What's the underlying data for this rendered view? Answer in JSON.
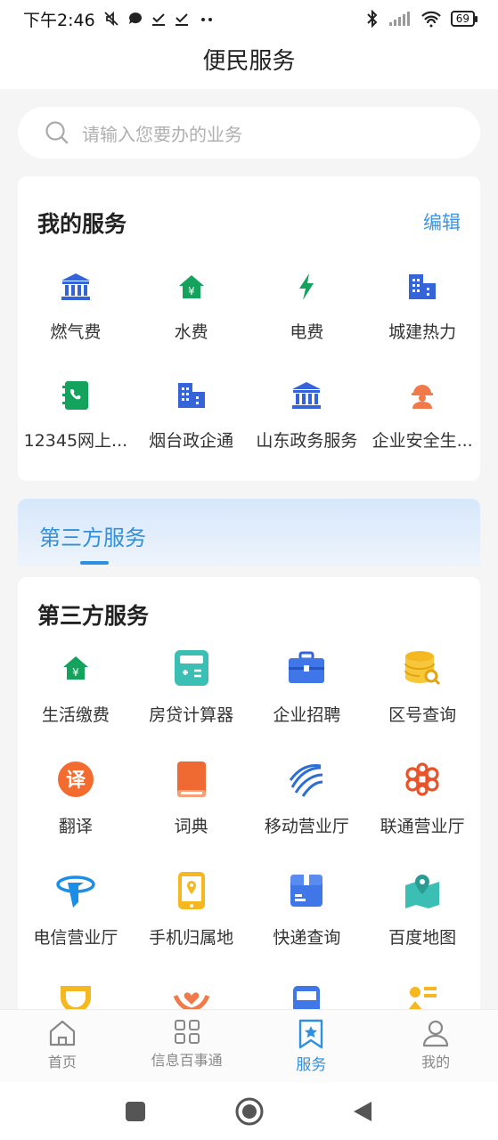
{
  "status_bar": {
    "time": "下午2:46",
    "battery": "69"
  },
  "header": {
    "title": "便民服务"
  },
  "search": {
    "placeholder": "请输入您要办的业务"
  },
  "my_services": {
    "title": "我的服务",
    "edit_label": "编辑",
    "items": [
      {
        "label": "燃气费",
        "icon": "bank-icon"
      },
      {
        "label": "水费",
        "icon": "house-yen-icon"
      },
      {
        "label": "电费",
        "icon": "lightning-icon"
      },
      {
        "label": "城建热力",
        "icon": "building-icon"
      },
      {
        "label": "12345网上...",
        "icon": "phonebook-icon"
      },
      {
        "label": "烟台政企通",
        "icon": "building-icon"
      },
      {
        "label": "山东政务服务",
        "icon": "bank-icon"
      },
      {
        "label": "企业安全生...",
        "icon": "worker-helmet-icon"
      }
    ]
  },
  "tab": {
    "label": "第三方服务"
  },
  "third_party": {
    "title": "第三方服务",
    "items": [
      {
        "label": "生活缴费",
        "icon": "house-yen-icon"
      },
      {
        "label": "房贷计算器",
        "icon": "calculator-icon"
      },
      {
        "label": "企业招聘",
        "icon": "briefcase-icon"
      },
      {
        "label": "区号查询",
        "icon": "database-search-icon"
      },
      {
        "label": "翻译",
        "icon": "translate-icon"
      },
      {
        "label": "词典",
        "icon": "dictionary-icon"
      },
      {
        "label": "移动营业厅",
        "icon": "china-mobile-icon"
      },
      {
        "label": "联通营业厅",
        "icon": "china-unicom-icon"
      },
      {
        "label": "电信营业厅",
        "icon": "china-telecom-icon"
      },
      {
        "label": "手机归属地",
        "icon": "phone-location-icon"
      },
      {
        "label": "快递查询",
        "icon": "package-icon"
      },
      {
        "label": "百度地图",
        "icon": "map-pin-icon"
      }
    ]
  },
  "bottom_nav": [
    {
      "label": "首页",
      "icon": "home-icon"
    },
    {
      "label": "信息百事通",
      "icon": "grid-icon"
    },
    {
      "label": "服务",
      "icon": "bookmark-star-icon"
    },
    {
      "label": "我的",
      "icon": "user-icon"
    }
  ],
  "colors": {
    "accent": "#2f8fe0",
    "edit": "#3a96e8"
  }
}
